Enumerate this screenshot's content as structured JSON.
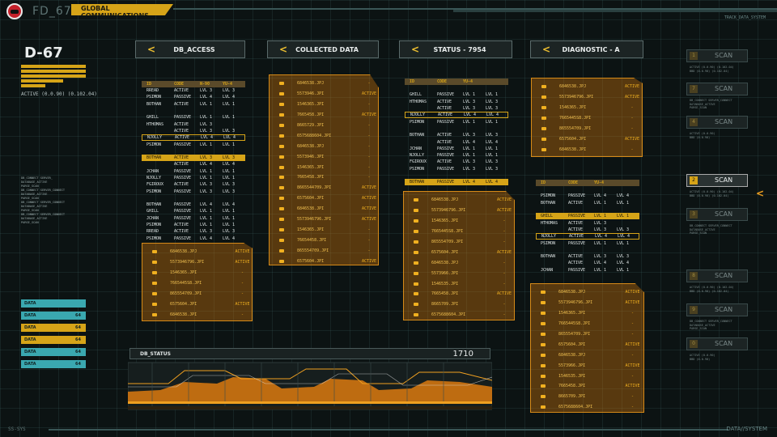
{
  "app": {
    "id": "FD_67",
    "title": "GLOBAL COMMUNICATIONS",
    "top_right": "TRACK_DATA_SYSTEM"
  },
  "left": {
    "title": "D-67",
    "active_line": "ACTIVE (0.0.90) (0.102.04)",
    "logs": [
      "DB_CONNECT       SERVER_",
      "DATABASE_ACTIVE",
      "PARSE_SCAN",
      "DB_CONNECT       SERVER_CONNECT",
      "DATABASE_ACTIVE",
      "PARSE_SCAN",
      "DB_CONNECT       SERVER_CONNECT",
      "DATABASE_ACTIVE",
      "PARSE_SCAN",
      "DB_CONNECT       SERVER_CONNECT",
      "DATABASE_ACTIVE",
      "PARSE_SCAN"
    ],
    "data_tags": [
      {
        "label": "DATA",
        "value": "",
        "color": "#3aa8b0"
      },
      {
        "label": "DATA",
        "value": "64",
        "color": "#3aa8b0"
      },
      {
        "label": "DATA",
        "value": "64",
        "color": "#d6a418"
      },
      {
        "label": "DATA",
        "value": "64",
        "color": "#d6a418"
      },
      {
        "label": "DATA",
        "value": "64",
        "color": "#3aa8b0"
      },
      {
        "label": "DATA",
        "value": "64",
        "color": "#3aa8b0"
      }
    ]
  },
  "headers": {
    "db_access": "DB_ACCESS",
    "collected": "COLLECTED DATA",
    "status": "STATUS - 7954",
    "diagnostic": "DIAGNOSTIC - A"
  },
  "db_access": {
    "columns": [
      "ID",
      "CODE",
      "N-90",
      "YU-4"
    ],
    "rows": [
      [
        "RREAD",
        "ACTIVE",
        "LVL 3",
        "LVL 3"
      ],
      [
        "PSIMON",
        "PASSIVE",
        "LVL 4",
        "LVL 4"
      ],
      [
        "BOTHAN",
        "ACTIVE",
        "LVL 1",
        "LVL 1"
      ],
      [
        "",
        "",
        "",
        ""
      ],
      [
        "GHILL",
        "PASSIVE",
        "LVL 1",
        "LVL 1"
      ],
      [
        "HTHOMAS",
        "ACTIVE",
        "LVL 3",
        ""
      ],
      [
        "",
        "ACTIVE",
        "LVL 3",
        "LVL 3"
      ],
      [
        "NJOLLY",
        "ACTIVE",
        "LVL 4",
        "LVL 4"
      ],
      [
        "PSIMON",
        "PASSIVE",
        "LVL 1",
        "LVL 1"
      ],
      [
        "",
        "",
        "",
        ""
      ],
      [
        "BOTHAN",
        "ACTIVE",
        "LVL 3",
        "LVL 3"
      ],
      [
        "",
        "ACTIVE",
        "LVL 4",
        "LVL 4"
      ],
      [
        "JCHAN",
        "PASSIVE",
        "LVL 1",
        "LVL 1"
      ],
      [
        "NJOLLY",
        "PASSIVE",
        "LVL 1",
        "LVL 1"
      ],
      [
        "FGIROUX",
        "ACTIVE",
        "LVL 3",
        "LVL 3"
      ],
      [
        "PSIMON",
        "PASSIVE",
        "LVL 3",
        "LVL 3"
      ],
      [
        "",
        "",
        "",
        ""
      ],
      [
        "BOTHAN",
        "PASSIVE",
        "LVL 4",
        "LVL 4"
      ],
      [
        "GHILL",
        "PASSIVE",
        "LVL 1",
        "LVL 1"
      ],
      [
        "JCHAN",
        "PASSIVE",
        "LVL 1",
        "LVL 1"
      ],
      [
        "PSIMON",
        "ACTIVE",
        "LVL 1",
        "LVL 1"
      ],
      [
        "RREAD",
        "ACTIVE",
        "LVL 3",
        "LVL 3"
      ],
      [
        "PSIMON",
        "PASSIVE",
        "LVL 4",
        "LVL 4"
      ]
    ]
  },
  "status_table": {
    "columns": [
      "ID",
      "CODE",
      "YU-4",
      ""
    ],
    "rows": [
      [
        "",
        "",
        "",
        ""
      ],
      [
        "GHILL",
        "PASSIVE",
        "LVL 1",
        "LVL 1"
      ],
      [
        "HTHOMAS",
        "ACTIVE",
        "LVL 3",
        "LVL 3"
      ],
      [
        "",
        "ACTIVE",
        "LVL 3",
        "LVL 3"
      ],
      [
        "NJOLLY",
        "ACTIVE",
        "LVL 4",
        "LVL 4"
      ],
      [
        "PSIMON",
        "PASSIVE",
        "LVL 1",
        "LVL 1"
      ],
      [
        "",
        "",
        "",
        ""
      ],
      [
        "BOTHAN",
        "ACTIVE",
        "LVL 3",
        "LVL 3"
      ],
      [
        "",
        "ACTIVE",
        "LVL 4",
        "LVL 4"
      ],
      [
        "JCHAN",
        "PASSIVE",
        "LVL 1",
        "LVL 1"
      ],
      [
        "NJOLLY",
        "PASSIVE",
        "LVL 1",
        "LVL 1"
      ],
      [
        "FGIROUX",
        "ACTIVE",
        "LVL 3",
        "LVL 3"
      ],
      [
        "PSIMON",
        "PASSIVE",
        "LVL 3",
        "LVL 3"
      ],
      [
        "",
        "",
        "",
        ""
      ],
      [
        "BOTHAN",
        "PASSIVE",
        "LVL 4",
        "LVL 4"
      ]
    ]
  },
  "diag_table": {
    "columns": [
      "ID",
      "CODE",
      "YU-4",
      ""
    ],
    "rows": [
      [
        "",
        "",
        "",
        ""
      ],
      [
        "PSIMON",
        "PASSIVE",
        "LVL 4",
        "LVL 4"
      ],
      [
        "BOTHAN",
        "ACTIVE",
        "LVL 1",
        "LVL 1"
      ],
      [
        "",
        "",
        "",
        ""
      ],
      [
        "GHILL",
        "PASSIVE",
        "LVL 1",
        "LVL 1"
      ],
      [
        "HTHOMAS",
        "ACTIVE",
        "LVL 3",
        ""
      ],
      [
        "",
        "ACTIVE",
        "LVL 3",
        "LVL 3"
      ],
      [
        "NJOLLY",
        "ACTIVE",
        "LVL 4",
        "LVL 4"
      ],
      [
        "PSIMON",
        "PASSIVE",
        "LVL 1",
        "LVL 1"
      ],
      [
        "",
        "",
        "",
        ""
      ],
      [
        "BOTHAN",
        "ACTIVE",
        "LVL 3",
        "LVL 3"
      ],
      [
        "",
        "ACTIVE",
        "LVL 4",
        "LVL 4"
      ],
      [
        "JCHAN",
        "PASSIVE",
        "LVL 1",
        "LVL 1"
      ]
    ]
  },
  "files_a": [
    [
      "6846538.JPJ",
      "ACTIVE"
    ],
    [
      "5573946796.JPI",
      "ACTIVE"
    ],
    [
      "1546365.JPI",
      "-"
    ],
    [
      "7665445S8.JPI",
      "-"
    ],
    [
      "865554709.JPI",
      "-"
    ],
    [
      "6575604.JPI",
      "ACTIVE"
    ],
    [
      "6846538.JPI",
      "-"
    ]
  ],
  "files_collected": [
    [
      "6846538.JPJ",
      "-"
    ],
    [
      "5573946.JPI",
      "ACTIVE"
    ],
    [
      "1546365.JPI",
      "-"
    ],
    [
      "7665458.JPI",
      "ACTIVE"
    ],
    [
      "8665729.JPI",
      "-"
    ],
    [
      "6575688604.JPI",
      "-"
    ],
    [
      "6846538.JPJ",
      "-"
    ],
    [
      "5573946.JPI",
      "-"
    ],
    [
      "1546365.JPI",
      "-"
    ],
    [
      "7665458.JPI",
      "-"
    ],
    [
      "8665544709.JPI",
      "ACTIVE"
    ],
    [
      "6575604.JPI",
      "ACTIVE"
    ],
    [
      "6846538.JPI",
      "ACTIVE"
    ],
    [
      "5573946796.JPI",
      "ACTIVE"
    ],
    [
      "1546365.JPI",
      "-"
    ],
    [
      "76654458.JPI",
      "-"
    ],
    [
      "865554709.JPI",
      "-"
    ],
    [
      "6575604.JPI",
      "ACTIVE"
    ]
  ],
  "files_status": [
    [
      "6846538.JPJ",
      "ACTIVE"
    ],
    [
      "5573946796.JPI",
      "ACTIVE"
    ],
    [
      "1546365.JPI",
      "-"
    ],
    [
      "7665445S8.JPI",
      "-"
    ],
    [
      "865554709.JPI",
      "-"
    ],
    [
      "6575604.JPI",
      "ACTIVE"
    ],
    [
      "6846538.JPJ",
      "-"
    ],
    [
      "5573966.JPI",
      "-"
    ],
    [
      "1546535.JPI",
      "-"
    ],
    [
      "7665458.JPI",
      "ACTIVE"
    ],
    [
      "8665709.JPI",
      "-"
    ],
    [
      "6575688604.JPI",
      "-"
    ]
  ],
  "files_diag_top": [
    [
      "6846538.JPJ",
      "ACTIVE"
    ],
    [
      "5573946796.JPI",
      "ACTIVE"
    ],
    [
      "1546365.JPI",
      "-"
    ],
    [
      "7665445S8.JPI",
      "-"
    ],
    [
      "865554709.JPI",
      "-"
    ],
    [
      "6575604.JPI",
      "ACTIVE"
    ],
    [
      "6846538.JPI",
      "-"
    ]
  ],
  "files_diag_bottom": [
    [
      "6846538.JPJ",
      "ACTIVE"
    ],
    [
      "5573946796.JPI",
      "ACTIVE"
    ],
    [
      "1546365.JPI",
      "-"
    ],
    [
      "7665445S8.JPI",
      "-"
    ],
    [
      "865554709.JPI",
      "-"
    ],
    [
      "6575604.JPI",
      "ACTIVE"
    ],
    [
      "6846538.JPJ",
      "-"
    ],
    [
      "5573966.JPI",
      "ACTIVE"
    ],
    [
      "1546535.JPI",
      "-"
    ],
    [
      "7665458.JPI",
      "ACTIVE"
    ],
    [
      "8665709.JPI",
      "-"
    ],
    [
      "6575688604.JPI",
      "-"
    ]
  ],
  "scan": {
    "label": "SCAN",
    "items": [
      {
        "num": "1",
        "active": false,
        "detail": [
          "ACTIVE (0.0.90) (0.102.04)",
          "BBD (0.0.90) (0.102.04)"
        ]
      },
      {
        "num": "7",
        "active": false,
        "detail": [
          "DB_CONNECT   SERVER_CONNECT",
          "DATABASE_ACTIVE",
          "PARSE_SCAN"
        ]
      },
      {
        "num": "4",
        "active": false,
        "detail": [
          "ACTIVE (0.0.90)",
          "BBD (0.0.90)"
        ]
      },
      {
        "num": "2",
        "active": true,
        "detail": [
          "ACTIVE (0.0.90) (0.102.04)",
          "BBD (0.0.90) (0.102.04)"
        ]
      },
      {
        "num": "3",
        "active": false,
        "detail": [
          "DB_CONNECT   SERVER_CONNECT",
          "DATABASE_ACTIVE",
          "PARSE_SCAN"
        ]
      },
      {
        "num": "8",
        "active": false,
        "detail": [
          "ACTIVE (0.0.90) (0.102.04)",
          "BBD (0.0.90) (0.102.04)"
        ]
      },
      {
        "num": "9",
        "active": false,
        "detail": [
          "DB_CONNECT   SERVER_CONNECT",
          "DATABASE_ACTIVE",
          "PARSE_SCAN"
        ]
      },
      {
        "num": "0",
        "active": false,
        "detail": [
          "ACTIVE (0.0.90)",
          "BBD (0.0.90)"
        ]
      }
    ]
  },
  "db_status": {
    "label": "DB_STATUS",
    "value": "1710"
  },
  "bottom": {
    "left": "SS-SYS",
    "right": "DATA//SYSTEM"
  },
  "colors": {
    "accent": "#d6a418",
    "orange": "#e07810",
    "teal": "#3aa8b0"
  }
}
